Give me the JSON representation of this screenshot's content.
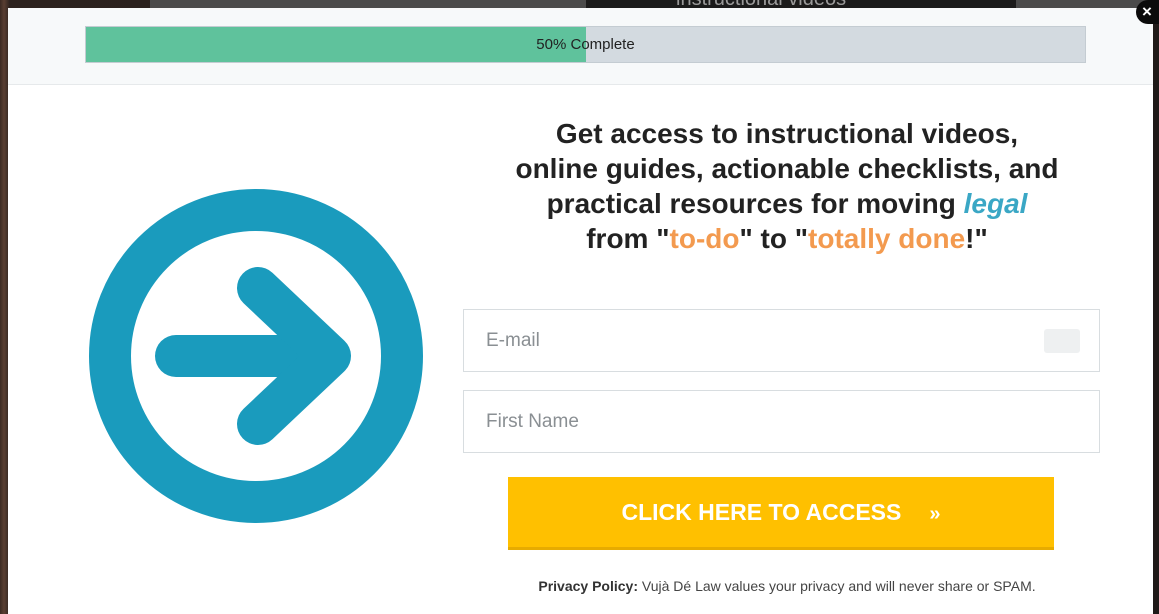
{
  "backdrop": {
    "video_label": "instructional videos"
  },
  "progress": {
    "label": "50% Complete",
    "percent": 50,
    "fill_color": "#5fc29c",
    "track_color": "#d3dae0"
  },
  "close": {
    "label": "×"
  },
  "headline": {
    "line1": "Get access to instructional videos,",
    "line2": "online guides, actionable checklists, and",
    "line3_prefix": "practical resources for moving ",
    "line3_highlight": "legal",
    "line4_from": "from \"",
    "line4_todo": "to-do",
    "line4_mid": "\" to \"",
    "line4_done": "totally done",
    "line4_end": "!\"",
    "accent_blue": "#3aa7c5",
    "accent_orange": "#f39a4f"
  },
  "form": {
    "email_placeholder": "E-mail",
    "name_placeholder": "First Name",
    "submit_label": "CLICK HERE TO ACCESS",
    "submit_chevron": "»",
    "submit_color": "#ffc000"
  },
  "privacy": {
    "label": "Privacy Policy:",
    "text": " Vujà Dé Law values your privacy and will never share or SPAM."
  },
  "graphic": {
    "icon": "arrow-right-circle-icon",
    "color": "#1a9bbd"
  }
}
